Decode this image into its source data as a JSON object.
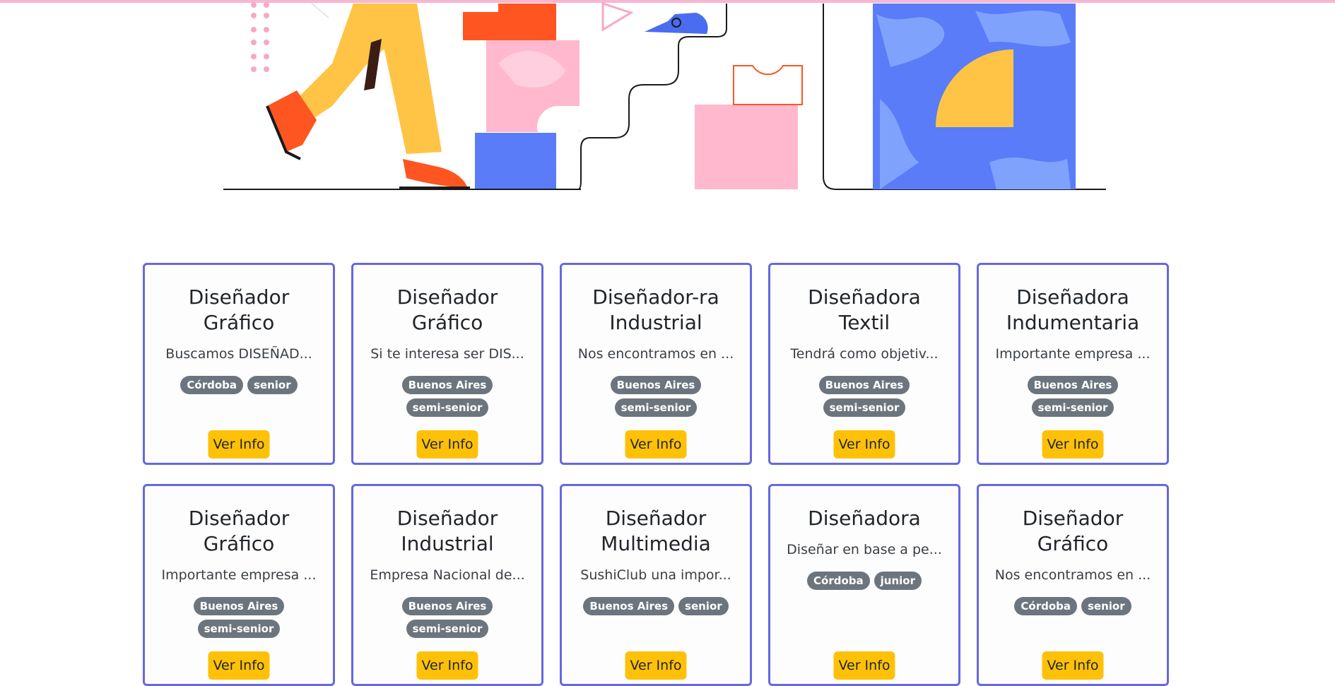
{
  "jobs": [
    {
      "title_line1": "Diseñador",
      "title_line2": "Gráfico",
      "description": "Buscamos DISEÑAD...",
      "location": "Córdoba",
      "level": "senior",
      "button": "Ver Info"
    },
    {
      "title_line1": "Diseñador",
      "title_line2": "Gráfico",
      "description": "Si te interesa ser DIS...",
      "location": "Buenos Aires",
      "level": "semi-senior",
      "button": "Ver Info"
    },
    {
      "title_line1": "Diseñador-ra",
      "title_line2": "Industrial",
      "description": "Nos encontramos en ...",
      "location": "Buenos Aires",
      "level": "semi-senior",
      "button": "Ver Info"
    },
    {
      "title_line1": "Diseñadora",
      "title_line2": "Textil",
      "description": "Tendrá como objetiv...",
      "location": "Buenos Aires",
      "level": "semi-senior",
      "button": "Ver Info"
    },
    {
      "title_line1": "Diseñadora",
      "title_line2": "Indumentaria",
      "description": "Importante empresa ...",
      "location": "Buenos Aires",
      "level": "semi-senior",
      "button": "Ver Info"
    },
    {
      "title_line1": "Diseñador",
      "title_line2": "Gráfico",
      "description": "Importante empresa ...",
      "location": "Buenos Aires",
      "level": "semi-senior",
      "button": "Ver Info"
    },
    {
      "title_line1": "Diseñador",
      "title_line2": "Industrial",
      "description": "Empresa Nacional de...",
      "location": "Buenos Aires",
      "level": "semi-senior",
      "button": "Ver Info"
    },
    {
      "title_line1": "Diseñador",
      "title_line2": "Multimedia",
      "description": "SushiClub una impor...",
      "location": "Buenos Aires",
      "level": "senior",
      "button": "Ver Info"
    },
    {
      "title_line1": "Diseñadora",
      "title_line2": "",
      "description": "Diseñar en base a pe...",
      "location": "Córdoba",
      "level": "junior",
      "button": "Ver Info"
    },
    {
      "title_line1": "Diseñador",
      "title_line2": "Gráfico",
      "description": "Nos encontramos en ...",
      "location": "Córdoba",
      "level": "senior",
      "button": "Ver Info"
    }
  ]
}
